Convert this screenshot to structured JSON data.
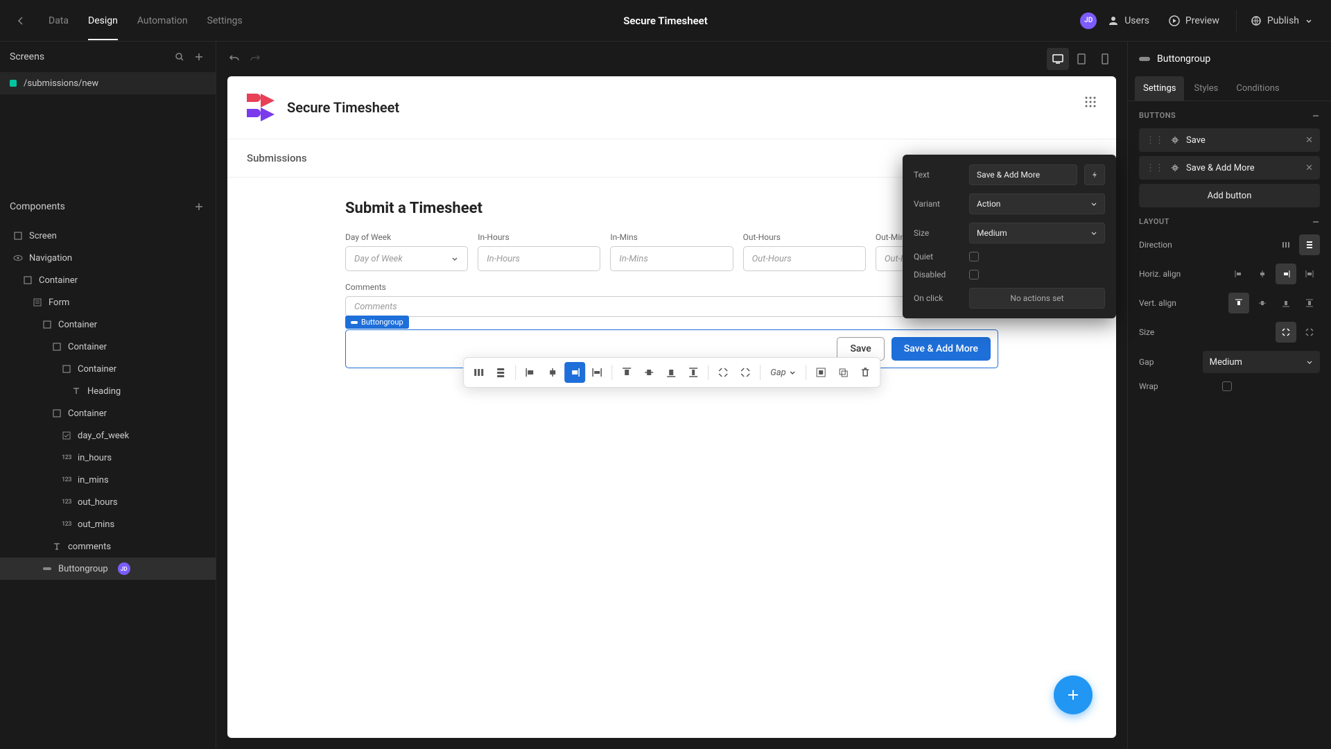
{
  "top": {
    "tabs": [
      "Data",
      "Design",
      "Automation",
      "Settings"
    ],
    "active_tab": 1,
    "title": "Secure Timesheet",
    "avatar": "JD",
    "users": "Users",
    "preview": "Preview",
    "publish": "Publish"
  },
  "left": {
    "screens_label": "Screens",
    "screen_name": "/submissions/new",
    "components_label": "Components",
    "tree": [
      {
        "icon": "square",
        "label": "Screen",
        "depth": 0
      },
      {
        "icon": "eye",
        "label": "Navigation",
        "depth": 0
      },
      {
        "icon": "square",
        "label": "Container",
        "depth": 1
      },
      {
        "icon": "form",
        "label": "Form",
        "depth": 2
      },
      {
        "icon": "square",
        "label": "Container",
        "depth": 3
      },
      {
        "icon": "square",
        "label": "Container",
        "depth": 4
      },
      {
        "icon": "square",
        "label": "Container",
        "depth": 5
      },
      {
        "icon": "text",
        "label": "Heading",
        "depth": 6
      },
      {
        "icon": "square",
        "label": "Container",
        "depth": 4
      },
      {
        "icon": "check",
        "label": "day_of_week",
        "depth": 5
      },
      {
        "icon": "num",
        "label": "in_hours",
        "depth": 5
      },
      {
        "icon": "num",
        "label": "in_mins",
        "depth": 5
      },
      {
        "icon": "num",
        "label": "out_hours",
        "depth": 5
      },
      {
        "icon": "num",
        "label": "out_mins",
        "depth": 5
      },
      {
        "icon": "textT",
        "label": "comments",
        "depth": 4
      },
      {
        "icon": "bg",
        "label": "Buttongroup",
        "depth": 3,
        "selected": true,
        "avatar": "JD"
      }
    ]
  },
  "canvas": {
    "app_title": "Secure Timesheet",
    "subnav": "Submissions",
    "form_title": "Submit a Timesheet",
    "fields": {
      "day_label": "Day of Week",
      "day_ph": "Day of Week",
      "inh_label": "In-Hours",
      "inh_ph": "In-Hours",
      "inm_label": "In-Mins",
      "inm_ph": "In-Mins",
      "outh_label": "Out-Hours",
      "outh_ph": "Out-Hours",
      "outm_label": "Out-Mins",
      "outm_ph": "Out-Mins",
      "comments_label": "Comments",
      "comments_ph": "Comments"
    },
    "bg_tag": "Buttongroup",
    "save_btn": "Save",
    "save_add_btn": "Save & Add More",
    "ft_gap": "Gap"
  },
  "popover": {
    "text_label": "Text",
    "text_value": "Save & Add More",
    "variant_label": "Variant",
    "variant_value": "Action",
    "size_label": "Size",
    "size_value": "Medium",
    "quiet_label": "Quiet",
    "disabled_label": "Disabled",
    "onclick_label": "On click",
    "onclick_value": "No actions set"
  },
  "right": {
    "component_name": "Buttongroup",
    "tabs": [
      "Settings",
      "Styles",
      "Conditions"
    ],
    "active_tab": 0,
    "buttons_section": "BUTTONS",
    "buttons": [
      "Save",
      "Save & Add More"
    ],
    "add_button": "Add button",
    "layout_section": "LAYOUT",
    "direction_label": "Direction",
    "halign_label": "Horiz. align",
    "valign_label": "Vert. align",
    "size_label": "Size",
    "gap_label": "Gap",
    "gap_value": "Medium",
    "wrap_label": "Wrap"
  }
}
